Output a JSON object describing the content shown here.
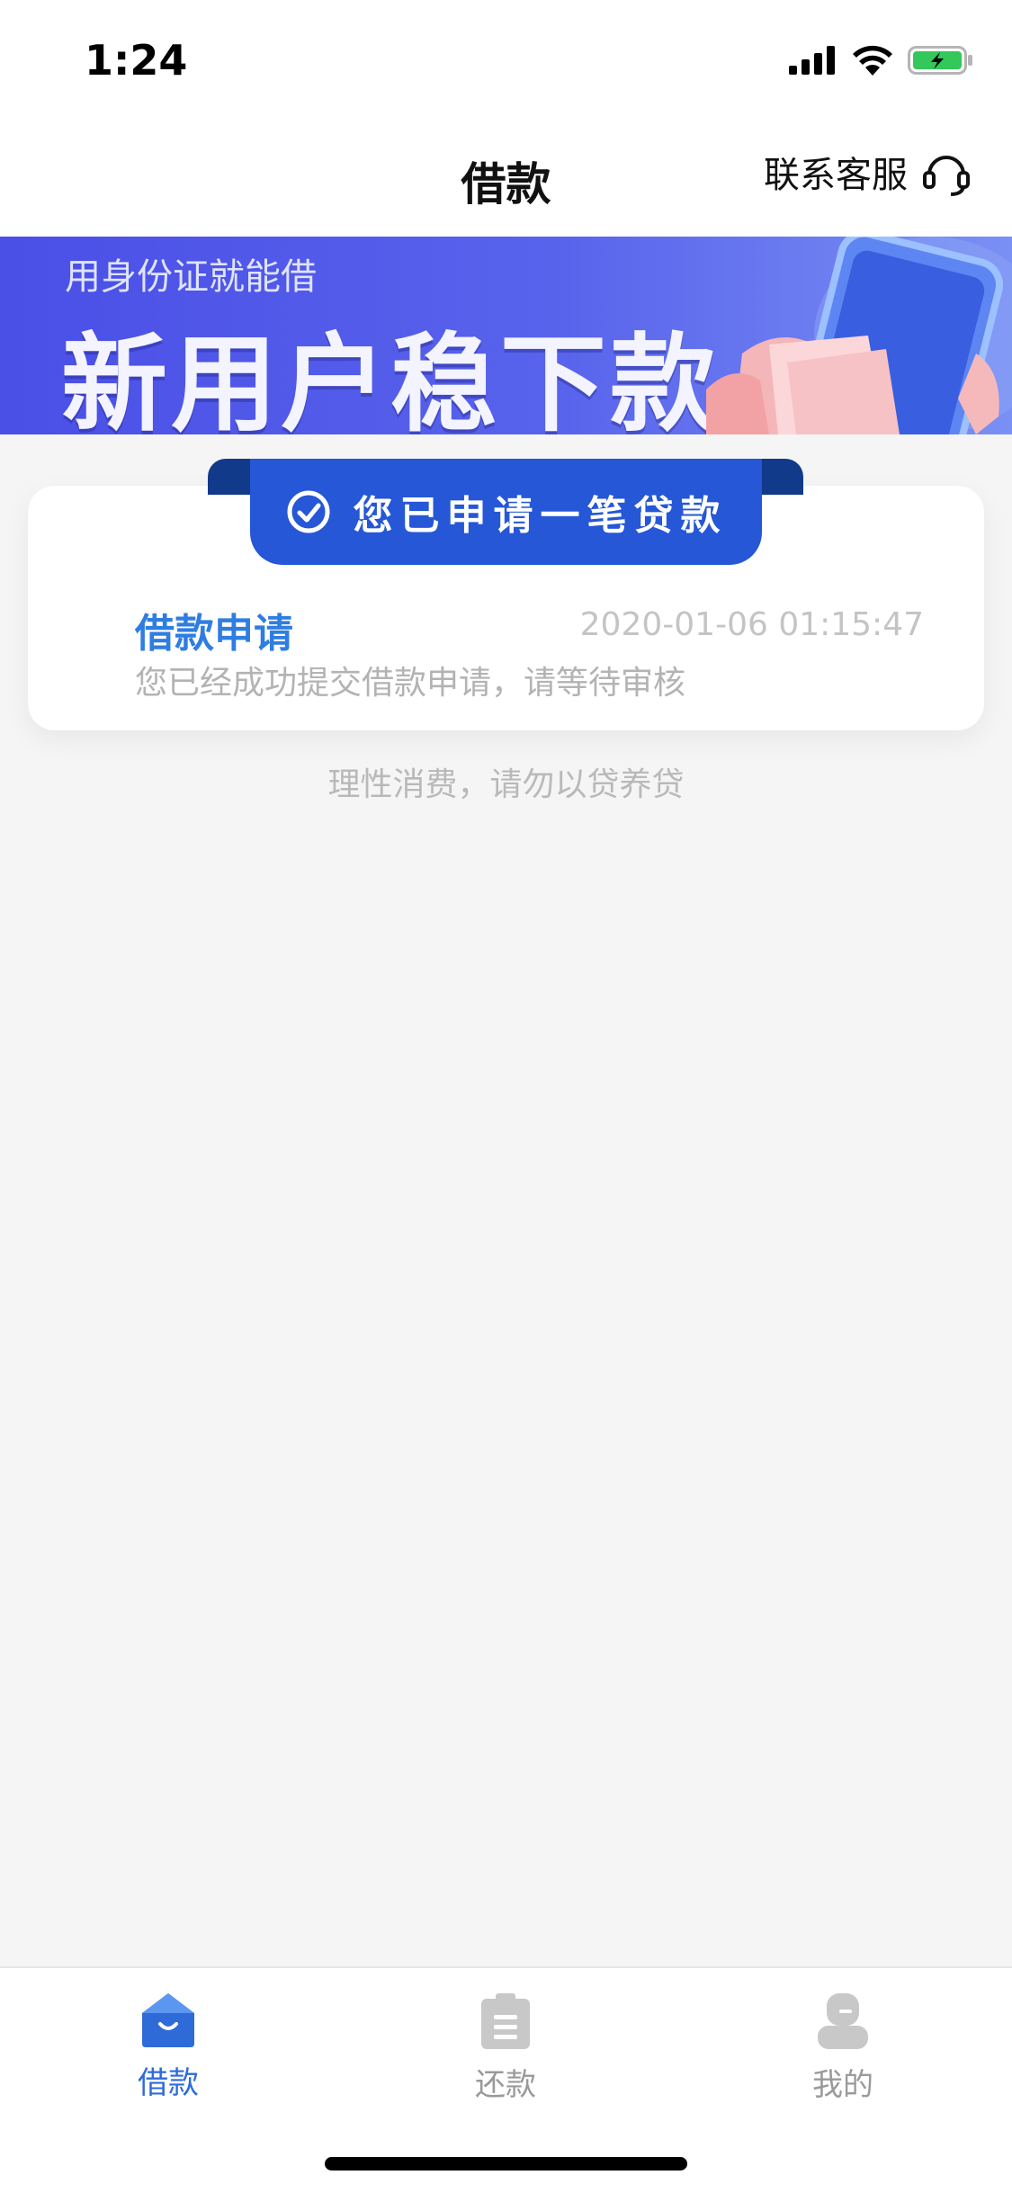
{
  "status_bar": {
    "time": "1:24",
    "icons": [
      "signal-icon",
      "wifi-icon",
      "battery-charging-icon"
    ]
  },
  "header": {
    "title": "借款",
    "support_label": "联系客服",
    "support_icon": "headset-icon"
  },
  "banner": {
    "subtitle": "用身份证就能借",
    "headline": "新用户稳下款"
  },
  "status_card": {
    "ribbon_text": "您已申请一笔贷款",
    "ribbon_icon": "check-circle-icon",
    "title": "借款申请",
    "timestamp": "2020-01-06 01:15:47",
    "description": "您已经成功提交借款申请，请等待审核"
  },
  "notice": "理性消费，请勿以贷养贷",
  "tabbar": {
    "items": [
      {
        "label": "借款",
        "icon": "loan-house-icon",
        "active": true
      },
      {
        "label": "还款",
        "icon": "clipboard-icon",
        "active": false
      },
      {
        "label": "我的",
        "icon": "user-icon",
        "active": false
      }
    ]
  },
  "colors": {
    "accent": "#2f6bd8",
    "ribbon": "#2557d6",
    "banner_start": "#4a4fe6",
    "banner_end": "#7a90f4",
    "muted_text": "#b3b3b3"
  }
}
